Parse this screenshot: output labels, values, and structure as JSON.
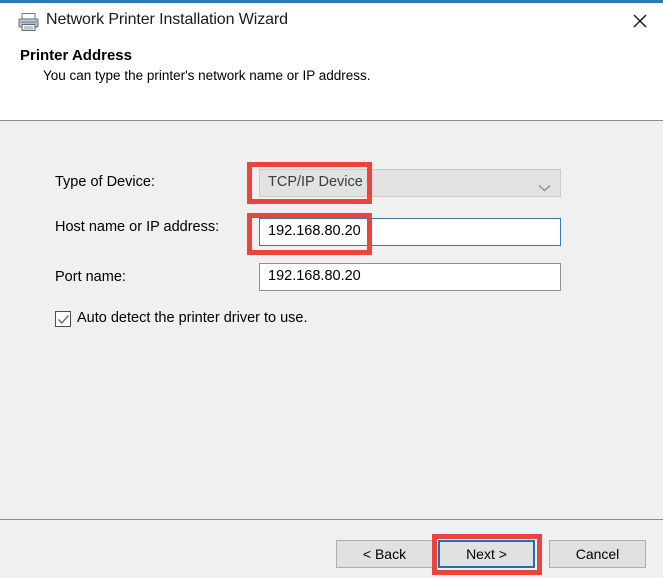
{
  "window": {
    "title": "Network Printer Installation Wizard",
    "icon": "printer-icon",
    "close_label": "✕",
    "accent_color": "#2a7ab0"
  },
  "header": {
    "title": "Printer Address",
    "subtitle": "You can type the printer's network name or IP address."
  },
  "form": {
    "device_type": {
      "label": "Type of Device:",
      "value": "TCP/IP Device",
      "options": [
        "TCP/IP Device"
      ],
      "disabled": true,
      "dropdown_icon": "chevron-down-icon"
    },
    "host": {
      "label": "Host name or IP address:",
      "value": "192.168.80.20",
      "placeholder": "",
      "focused": true,
      "focus_color": "#3a7cb0"
    },
    "port": {
      "label": "Port name:",
      "value": "192.168.80.20",
      "placeholder": ""
    },
    "auto_detect": {
      "label": "Auto detect the printer driver to use.",
      "checked": true,
      "check_icon": "check-icon"
    }
  },
  "footer": {
    "back_label": "< Back",
    "next_label": "Next >",
    "cancel_label": "Cancel",
    "default_button": "Next >"
  },
  "annotations": {
    "color": "#e8453c",
    "boxes": [
      {
        "name": "device-type-combo",
        "target": "TCP/IP Device"
      },
      {
        "name": "host-address-input",
        "target": "192.168.80.20"
      },
      {
        "name": "next-button",
        "target": "Next >"
      }
    ]
  }
}
